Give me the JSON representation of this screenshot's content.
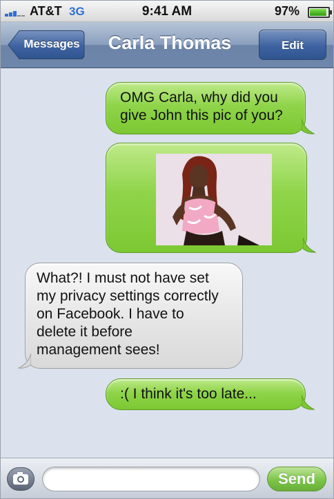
{
  "status_bar": {
    "carrier": "AT&T",
    "network": "3G",
    "time": "9:41 AM",
    "battery": "97%",
    "battery_level": 0.97
  },
  "nav": {
    "back_label": "Messages",
    "title": "Carla Thomas",
    "edit_label": "Edit"
  },
  "messages": [
    {
      "sender": "me",
      "lines": [
        "OMG Carla, why did you",
        "give John this pic of you?"
      ]
    },
    {
      "sender": "me",
      "type": "photo"
    },
    {
      "sender": "contact",
      "lines": [
        "What?! I must not have set",
        "my privacy settings correctly",
        "on Facebook. I have to",
        "delete it before",
        "management sees!"
      ]
    },
    {
      "sender": "me",
      "lines": [
        ":( I think it's too late..."
      ]
    }
  ],
  "composer": {
    "value": "",
    "send_label": "Send"
  },
  "icons": {
    "camera": "camera-icon",
    "back": "chevron-left-icon"
  },
  "colors": {
    "outgoing_bubble": "#8fd44a",
    "incoming_bubble": "#e4e4e4",
    "nav_bar": "#6c84a8",
    "send_button": "#6cc12c"
  }
}
